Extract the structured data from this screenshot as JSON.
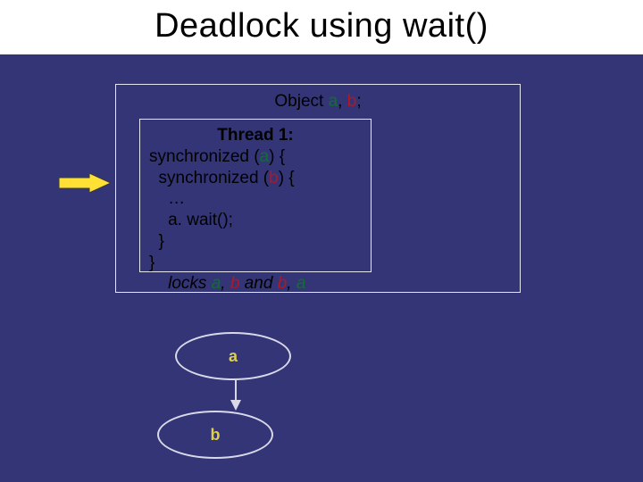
{
  "slide": {
    "title": "Deadlock using wait()"
  },
  "object_decl": {
    "prefix": "Object",
    "a": "a",
    "comma": ",",
    "b": "b",
    "semicolon": ";"
  },
  "thread_box": {
    "title": "Thread 1:",
    "line1_pre": "synchronized (",
    "line1_a": "a",
    "line1_post": ") {",
    "line2_pre": "  synchronized (",
    "line2_b": "b",
    "line2_post": ") {",
    "line3": "    …",
    "line4": "    a. wait();",
    "line5": "  }",
    "line6": "}",
    "locks_pre": "    locks ",
    "locks_a1": "a",
    "locks_c1": ", ",
    "locks_b1": "b",
    "locks_and": " and ",
    "locks_b2": "b",
    "locks_c2": ", ",
    "locks_a2": "a"
  },
  "nodes": {
    "a": "a",
    "b": "b"
  },
  "chart_data": {
    "type": "diagram",
    "title": "Deadlock using wait()",
    "nodes": [
      {
        "id": "a",
        "label": "a"
      },
      {
        "id": "b",
        "label": "b"
      }
    ],
    "edges": [
      {
        "from": "a",
        "to": "b"
      }
    ],
    "code": [
      "Object a, b;",
      "Thread 1:",
      "synchronized (a) {",
      "  synchronized (b) {",
      "    …",
      "    a.wait();",
      "  }",
      "}",
      "locks a, b and b, a"
    ]
  }
}
